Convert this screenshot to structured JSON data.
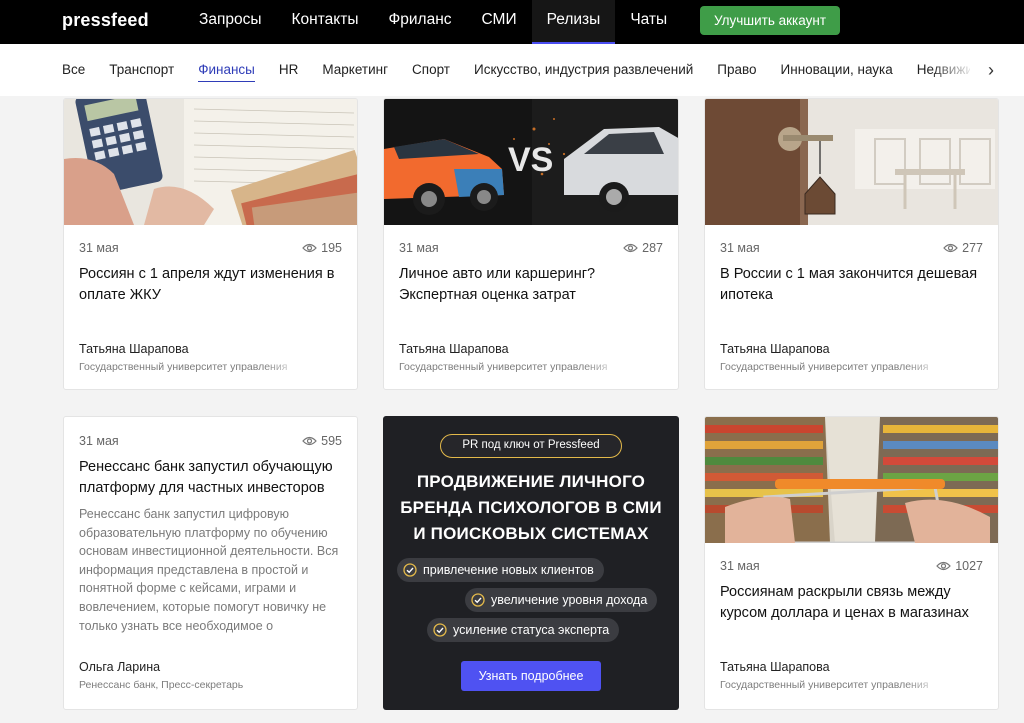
{
  "header": {
    "logo": "pressfeed",
    "nav": [
      {
        "label": "Запросы"
      },
      {
        "label": "Контакты"
      },
      {
        "label": "Фриланс"
      },
      {
        "label": "СМИ"
      },
      {
        "label": "Релизы",
        "active": true
      },
      {
        "label": "Чаты"
      }
    ],
    "upgrade_label": "Улучшить аккаунт"
  },
  "categories": {
    "items": [
      {
        "label": "Все"
      },
      {
        "label": "Транспорт"
      },
      {
        "label": "Финансы",
        "active": true
      },
      {
        "label": "HR"
      },
      {
        "label": "Маркетинг"
      },
      {
        "label": "Спорт"
      },
      {
        "label": "Искусство, индустрия развлечений"
      },
      {
        "label": "Право"
      },
      {
        "label": "Инновации, наука"
      },
      {
        "label": "Недвижимость"
      }
    ],
    "next_icon": "chevron-right-icon"
  },
  "cards": [
    {
      "image": "calculator-bills-image",
      "date": "31 мая",
      "views": "195",
      "title": "Россиян с 1 апреля ждут изменения в оплате ЖКУ",
      "author": "Татьяна Шарапова",
      "org": "Государственный университет управления"
    },
    {
      "image": "cars-versus-image",
      "date": "31 мая",
      "views": "287",
      "title": "Личное авто или каршеринг? Экспертная оценка затрат",
      "author": "Татьяна Шарапова",
      "org": "Государственный университет управления"
    },
    {
      "image": "house-key-image",
      "date": "31 мая",
      "views": "277",
      "title": "В России с 1 мая закончится дешевая ипотека",
      "author": "Татьяна Шарапова",
      "org": "Государственный университет управления"
    },
    {
      "date": "31 мая",
      "views": "595",
      "title": "Ренессанс банк запустил обучающую платформу для частных инвесторов",
      "excerpt": "Ренессанс банк запустил цифровую образовательную платформу по обучению основам инвестиционной деятельности. Вся информация представлена в простой и понятной форме с кейсами, играми и вовлечением, которые помогут новичку не только узнать все необходимое о",
      "author": "Ольга Ларина",
      "org": "Ренессанс банк, Пресс-секретарь"
    },
    {
      "image": "supermarket-cart-image",
      "date": "31 мая",
      "views": "1027",
      "title": "Россиянам раскрыли связь между курсом доллара и ценах в магазинах",
      "author": "Татьяна Шарапова",
      "org": "Государственный университет управления"
    }
  ],
  "promo": {
    "tag": "PR под ключ от Pressfeed",
    "title": "ПРОДВИЖЕНИЕ ЛИЧНОГО БРЕНДА ПСИХОЛОГОВ В СМИ И ПОИСКОВЫХ СИСТЕМАХ",
    "points": [
      {
        "label": "привлечение новых клиентов"
      },
      {
        "label": "увеличение уровня дохода"
      },
      {
        "label": "усиление статуса эксперта"
      }
    ],
    "cta": "Узнать подробнее"
  },
  "colors": {
    "accent": "#4f52f2",
    "upgrade": "#3f9d48",
    "active_category": "#2f3db8",
    "promo_bg": "#1f2024",
    "promo_tag_border": "#e3b94a"
  }
}
